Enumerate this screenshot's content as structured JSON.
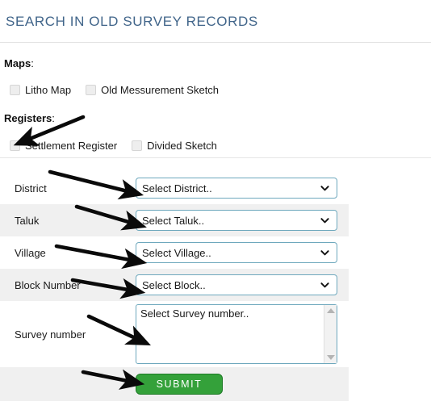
{
  "page": {
    "title": "SEARCH IN OLD SURVEY RECORDS",
    "title_color": "#41658a",
    "background": "#ffffff"
  },
  "sections": [
    {
      "heading": "Maps",
      "heading_suffix": ":",
      "checkboxes": [
        {
          "label": "Litho Map",
          "checked": false
        },
        {
          "label": "Old Messurement Sketch",
          "checked": false
        }
      ]
    },
    {
      "heading": "Registers",
      "heading_suffix": ":",
      "checkboxes": [
        {
          "label": "Settlement Register",
          "checked": false
        },
        {
          "label": "Divided Sketch",
          "checked": false
        }
      ]
    }
  ],
  "form": {
    "rows": [
      {
        "label": "District",
        "control": "select",
        "value": "Select District..",
        "striped": false
      },
      {
        "label": "Taluk",
        "control": "select",
        "value": "Select Taluk..",
        "striped": true
      },
      {
        "label": "Village",
        "control": "select",
        "value": "Select Village..",
        "striped": false
      },
      {
        "label": "Block Number",
        "control": "select",
        "value": "Select Block..",
        "striped": true
      },
      {
        "label": "Survey number",
        "control": "listbox",
        "value": "Select Survey number..",
        "striped": false
      }
    ],
    "submit": {
      "label": "SUBMIT",
      "color": "#34a13a",
      "border_color": "#1f7a27",
      "text_color": "#ffffff",
      "striped": true
    },
    "select_border_color": "#6ea8bd",
    "stripe_color": "#f0f0f0"
  },
  "annotations": {
    "arrow_color": "#0a0a0a",
    "count": 6,
    "targets": [
      "settlement-register-checkbox",
      "district-select",
      "taluk-select",
      "village-select",
      "block-number-select",
      "survey-number-listbox",
      "submit-button"
    ]
  },
  "icons": {
    "chevron_down": "chevron-down-icon",
    "scroll_up": "scroll-up-arrow-icon",
    "scroll_down": "scroll-down-arrow-icon"
  }
}
